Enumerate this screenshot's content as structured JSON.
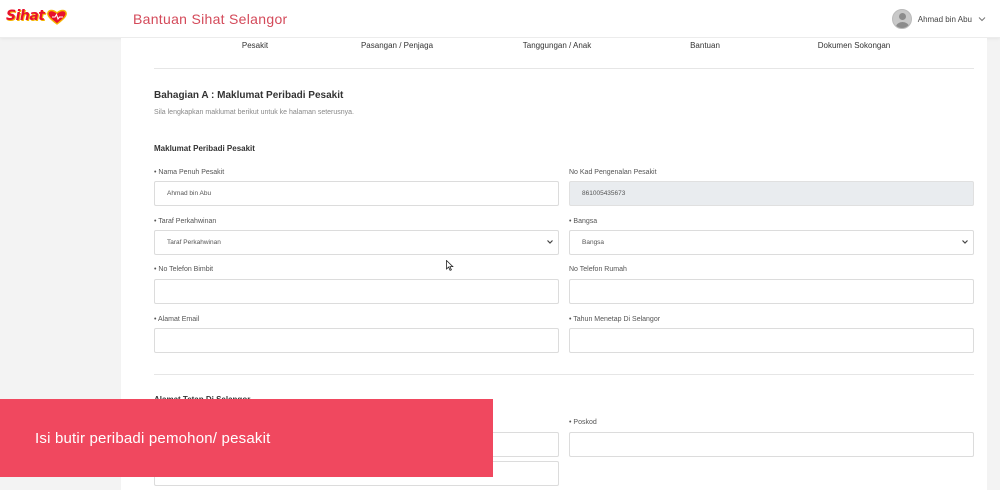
{
  "header": {
    "logo_text": "Sihat",
    "app_title": "Bantuan Sihat Selangor",
    "user_name": "Ahmad bin Abu"
  },
  "tabs": [
    {
      "label": "Pesakit"
    },
    {
      "label": "Pasangan / Penjaga"
    },
    {
      "label": "Tanggungan / Anak"
    },
    {
      "label": "Bantuan"
    },
    {
      "label": "Dokumen Sokongan"
    }
  ],
  "form": {
    "section_title": "Bahagian A : Maklumat Peribadi Pesakit",
    "section_subtitle": "Sila lengkapkan maklumat berikut untuk ke halaman seterusnya.",
    "group_title": "Maklumat Peribadi Pesakit",
    "fields": {
      "nama": {
        "label": "• Nama Penuh Pesakit",
        "value": "Ahmad bin Abu"
      },
      "ic": {
        "label": "No Kad Pengenalan Pesakit",
        "value": "861005435673"
      },
      "taraf": {
        "label": "• Taraf Perkahwinan",
        "value": "Taraf Perkahwinan"
      },
      "bangsa": {
        "label": "• Bangsa",
        "value": "Bangsa"
      },
      "bimbit": {
        "label": "• No Telefon Bimbit",
        "value": ""
      },
      "rumah": {
        "label": "No Telefon Rumah",
        "value": ""
      },
      "email": {
        "label": "• Alamat Email",
        "value": ""
      },
      "tahun": {
        "label": "• Tahun Menetap Di Selangor",
        "value": ""
      },
      "poskod": {
        "label": "• Poskod",
        "value": ""
      }
    },
    "address_title": "Alamat Tetap Di Selangor"
  },
  "overlay": {
    "caption": "Isi butir peribadi pemohon/ pesakit"
  },
  "colors": {
    "brand": "#d44a5a",
    "overlay": "#f0485f",
    "logo_red": "#e8112d",
    "logo_yellow": "#f5b400"
  }
}
